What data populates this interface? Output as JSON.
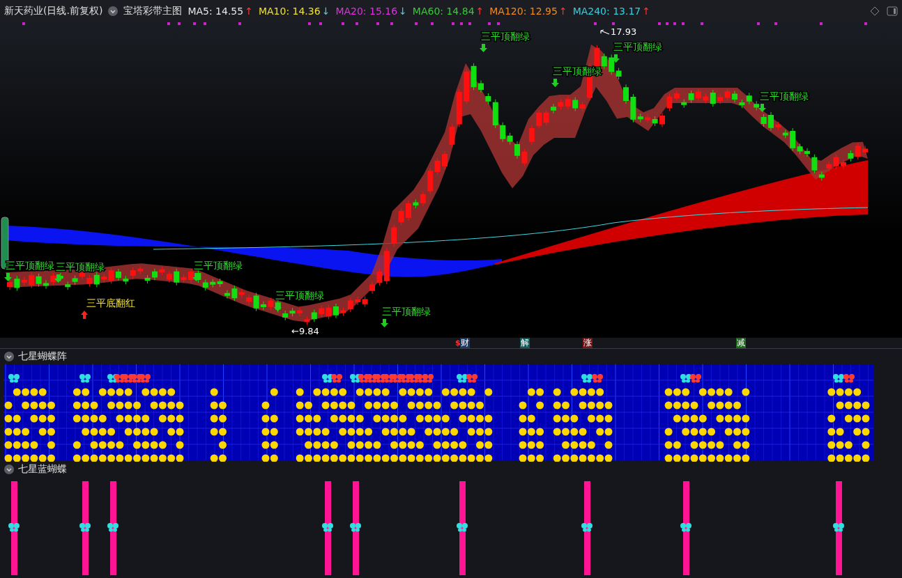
{
  "header": {
    "title": "新天药业(日线.前复权)",
    "indicator": "宝塔彩带主图",
    "mas": [
      {
        "label": "MA5: 14.55",
        "color": "#e6e6e6",
        "arrow": "↑",
        "rising": true
      },
      {
        "label": "MA10: 14.36",
        "color": "#f0e030",
        "arrow": "↓",
        "rising": false
      },
      {
        "label": "MA20: 15.16",
        "color": "#e030e0",
        "arrow": "↓",
        "rising": false
      },
      {
        "label": "MA60: 14.84",
        "color": "#30d030",
        "arrow": "↑",
        "rising": true
      },
      {
        "label": "MA120: 12.95",
        "color": "#f08a20",
        "arrow": "↑",
        "rising": true
      },
      {
        "label": "MA240: 13.17",
        "color": "#30d0e0",
        "arrow": "↑",
        "rising": true
      }
    ]
  },
  "main_chart": {
    "signals": [
      {
        "kind": "top-green",
        "text": "三平顶翻绿"
      },
      {
        "kind": "top-green",
        "text": "三平顶翻绿"
      },
      {
        "kind": "bottom-red",
        "text": "三平底翻红"
      },
      {
        "kind": "top-green",
        "text": "三平顶翻绿"
      },
      {
        "kind": "top-green",
        "text": "三平顶翻绿"
      },
      {
        "kind": "top-green",
        "text": "三平顶翻绿"
      },
      {
        "kind": "top-green",
        "text": "三平顶翻绿"
      },
      {
        "kind": "top-green",
        "text": "三平顶翻绿"
      },
      {
        "kind": "top-green",
        "text": "三平顶翻绿"
      },
      {
        "kind": "top-green",
        "text": "三平顶翻绿"
      }
    ],
    "high_label": "17.93",
    "low_label": "←9.84"
  },
  "event_markers": [
    {
      "prefix": "$",
      "label": "财",
      "color": "#1d3a66"
    },
    {
      "label": "解",
      "color": "#0e5a5a"
    },
    {
      "label": "涨",
      "color": "#7a1414"
    },
    {
      "label": "减",
      "color": "#1a6a1a"
    }
  ],
  "panels": [
    {
      "title": "七星蝴蝶阵"
    },
    {
      "title": "七星蓝蝴蝶"
    }
  ]
}
